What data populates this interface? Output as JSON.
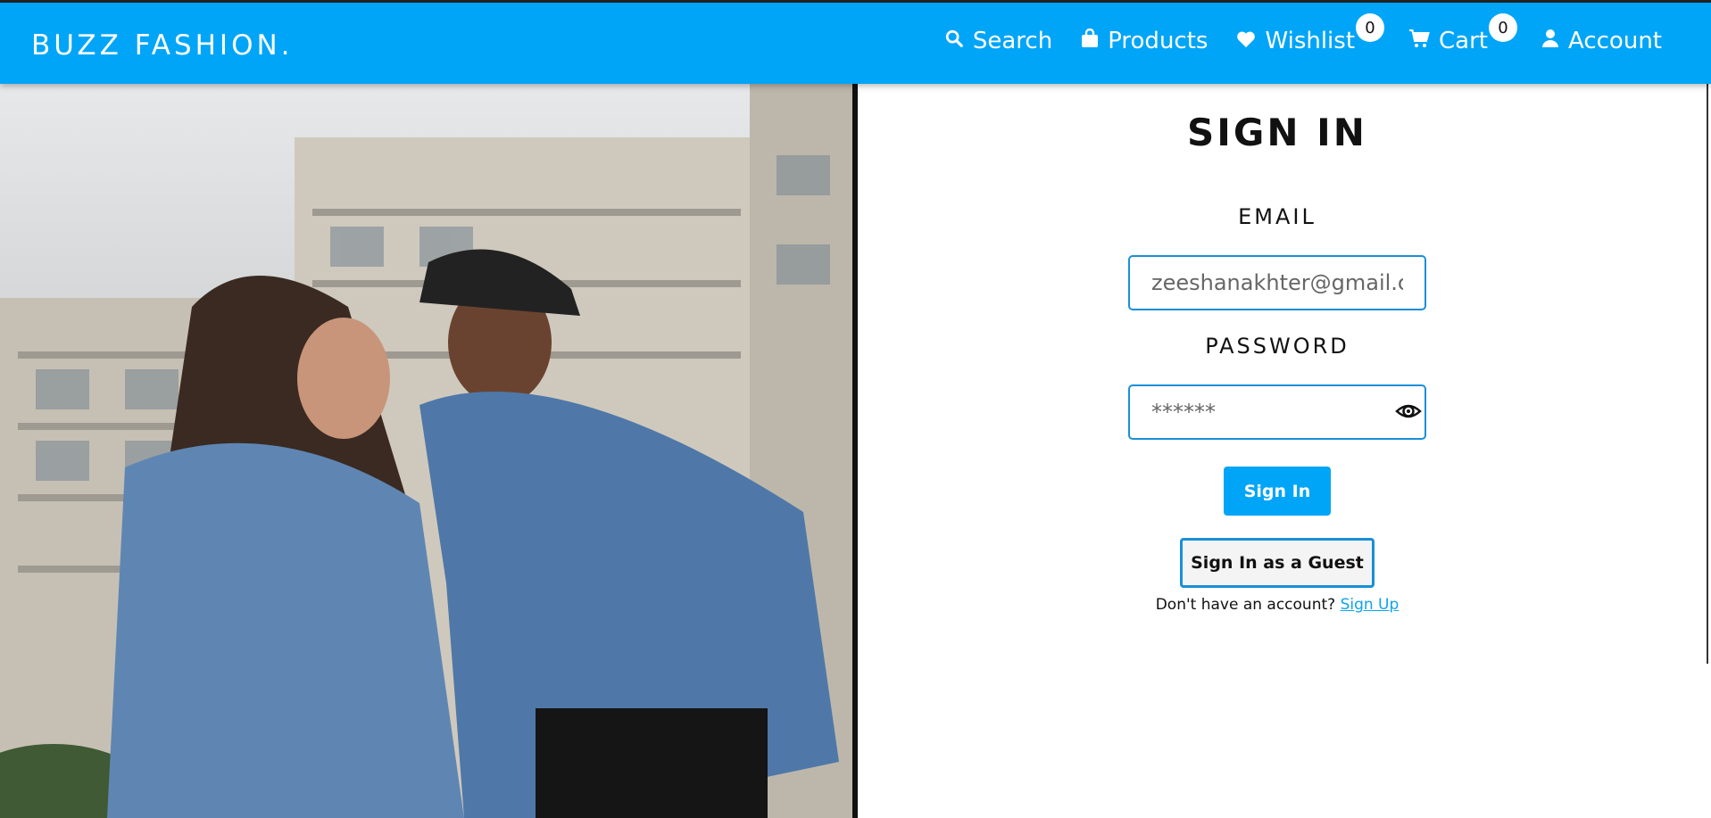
{
  "header": {
    "brand": "BUZZ FASHION.",
    "nav": [
      {
        "label": "Search",
        "icon": "search-icon"
      },
      {
        "label": "Products",
        "icon": "bag-icon"
      },
      {
        "label": "Wishlist",
        "icon": "heart-icon",
        "count": "0"
      },
      {
        "label": "Cart",
        "icon": "cart-icon",
        "count": "0"
      },
      {
        "label": "Account",
        "icon": "user-icon"
      }
    ],
    "accent": "#00a5f7"
  },
  "signin": {
    "title": "SIGN IN",
    "email_label": "EMAIL",
    "email_value": "zeeshanakhter@gmail.cc",
    "password_label": "PASSWORD",
    "password_value": "******",
    "submit_label": "Sign In",
    "guest_label": "Sign In as a Guest",
    "no_account_text": "Don't have an account? ",
    "signup_link": "Sign Up"
  }
}
